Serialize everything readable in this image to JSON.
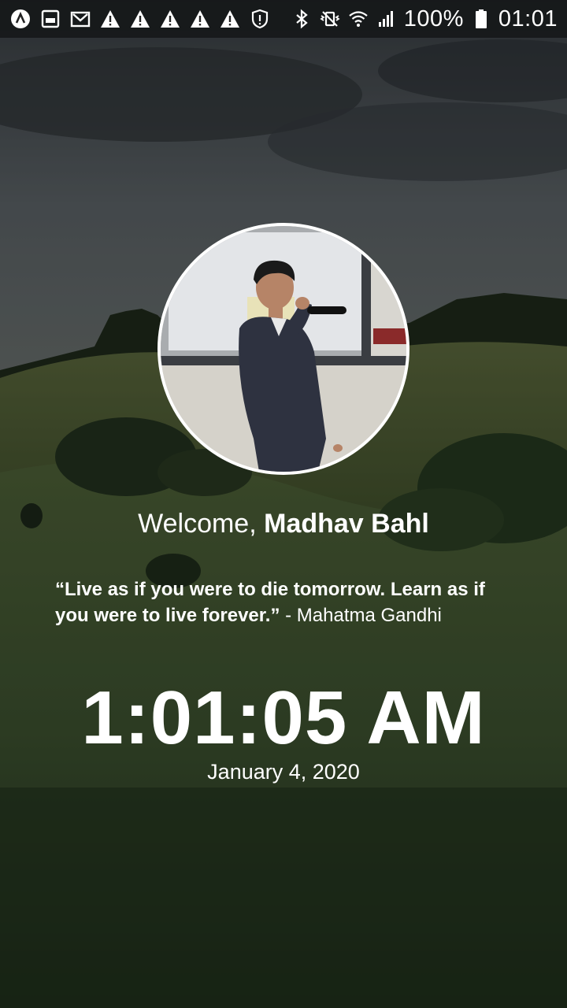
{
  "status_bar": {
    "left_icons": [
      "app-a-icon",
      "image-icon",
      "gmail-icon",
      "warning-icon",
      "warning-icon",
      "warning-icon",
      "warning-icon",
      "warning-icon",
      "shield-alert-icon"
    ],
    "right_icons": [
      "bluetooth-icon",
      "vibrate-mute-icon",
      "wifi-icon",
      "signal-icon"
    ],
    "battery_text": "100%",
    "time": "01:01"
  },
  "profile": {
    "avatar_icon": "profile-photo"
  },
  "welcome": {
    "prefix": "Welcome, ",
    "name": "Madhav Bahl"
  },
  "quote": {
    "text": "“Live as if you were to die tomorrow. Learn as if you were to live forever.”",
    "author": " - Mahatma Gandhi"
  },
  "clock": {
    "time": "1:01:05 AM",
    "date": "January 4, 2020"
  },
  "colors": {
    "text": "#ffffff",
    "status_bar_bg": "#141618"
  }
}
